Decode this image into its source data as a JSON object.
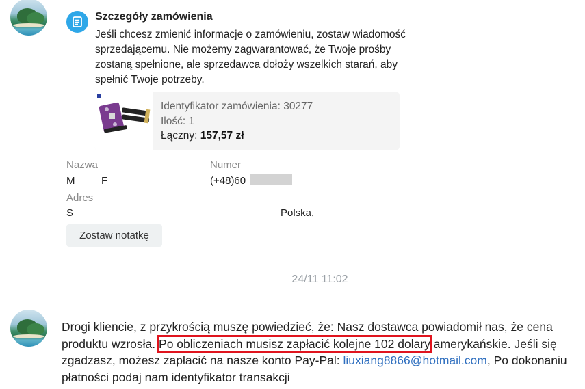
{
  "order_details": {
    "title": "Szczegóły zamówienia",
    "description": "Jeśli chcesz zmienić informacje o zamówieniu, zostaw wiadomość sprzedającemu. Nie możemy zagwarantować, że Twoje prośby zostaną spełnione, ale sprzedawca dołoży wszelkich starań, aby spełnić Twoje potrzeby.",
    "order_id_label": "Identyfikator zamówienia: 30277",
    "quantity_label": "Ilość: 1",
    "total_label": "Łączny:",
    "total_value": "157,57 zł"
  },
  "contact": {
    "name_label": "Nazwa",
    "name_value_1": "M",
    "name_value_2": "F",
    "phone_label": "Numer",
    "phone_value": "(+48)60",
    "address_label": "Adres",
    "address_value_1": "S",
    "address_value_2": "Polska,",
    "note_button": "Zostaw notatkę"
  },
  "timestamp": "24/11 11:02",
  "message": {
    "part1": "Drogi kliencie, z przykrością muszę powiedzieć, że: Nasz dostawca powiadomił nas,  że cena produktu wzrosła.",
    "highlight": "Po obliczeniach musisz zapłacić kolejne 102 dolary",
    "part2": " amerykańskie. Jeśli się zgadzasz, możesz zapłacić na nasze konto  Pay-Pal: ",
    "email": "liuxiang8866@hotmail.com",
    "part3": ", Po dokonaniu płatności podaj nam identyfikator transakcji"
  },
  "colors": {
    "accent_blue": "#2ea7e8",
    "highlight_red": "#e0141e",
    "link": "#2f6fbf"
  }
}
